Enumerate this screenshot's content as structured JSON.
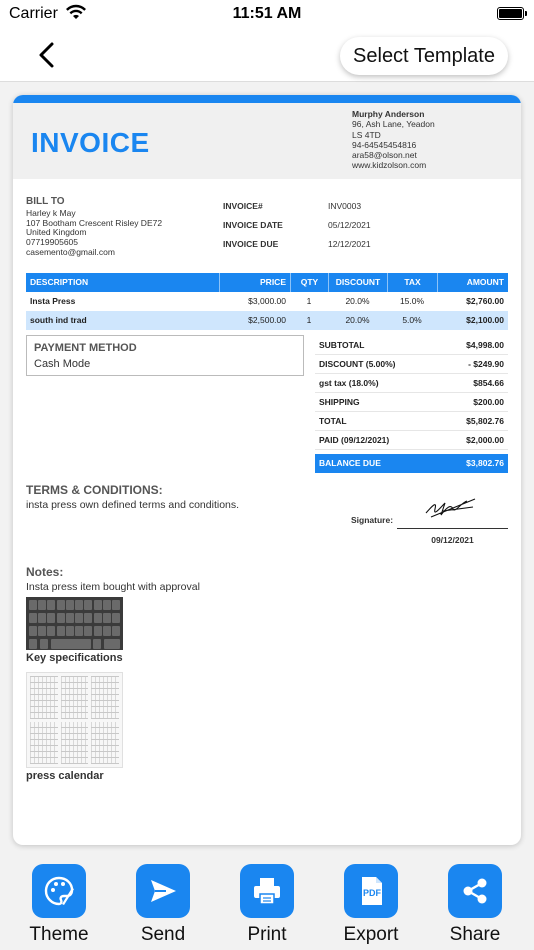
{
  "status_bar": {
    "carrier": "Carrier",
    "time": "11:51 AM"
  },
  "navbar": {
    "select_template_label": "Select Template"
  },
  "invoice": {
    "title": "INVOICE",
    "company": {
      "name": "Murphy Anderson",
      "address1": "96, Ash Lane, Yeadon",
      "address2": "LS 4TD",
      "phone": "94-64545454816",
      "email": "ara58@olson.net",
      "website": "www.kidzolson.com"
    },
    "bill_to": {
      "label": "BILL TO",
      "name": "Harley k May",
      "address": "107 Bootham Crescent Risley DE72",
      "country": "United Kingdom",
      "phone": "07719905605",
      "email": "casemento@gmail.com"
    },
    "meta": [
      {
        "label": "INVOICE#",
        "value": "INV0003"
      },
      {
        "label": "INVOICE DATE",
        "value": "05/12/2021"
      },
      {
        "label": "INVOICE DUE",
        "value": "12/12/2021"
      }
    ],
    "columns": [
      "DESCRIPTION",
      "PRICE",
      "QTY",
      "DISCOUNT",
      "TAX",
      "AMOUNT"
    ],
    "items": [
      {
        "description": "Insta Press",
        "price": "$3,000.00",
        "qty": "1",
        "discount": "20.0%",
        "tax": "15.0%",
        "amount": "$2,760.00"
      },
      {
        "description": "south ind trad",
        "price": "$2,500.00",
        "qty": "1",
        "discount": "20.0%",
        "tax": "5.0%",
        "amount": "$2,100.00"
      }
    ],
    "payment": {
      "title": "PAYMENT METHOD",
      "value": "Cash Mode"
    },
    "totals": [
      {
        "label": "SUBTOTAL",
        "value": "$4,998.00"
      },
      {
        "label": "DISCOUNT (5.00%)",
        "value": "- $249.90"
      },
      {
        "label": "gst tax (18.0%)",
        "value": "$854.66"
      },
      {
        "label": "SHIPPING",
        "value": "$200.00"
      },
      {
        "label": "TOTAL",
        "value": "$5,802.76"
      },
      {
        "label": "PAID (09/12/2021)",
        "value": "$2,000.00"
      }
    ],
    "balance": {
      "label": "BALANCE DUE",
      "value": "$3,802.76"
    },
    "terms": {
      "title": "TERMS & CONDITIONS:",
      "text": "insta press own defined terms and conditions."
    },
    "signature": {
      "label": "Signature:",
      "date": "09/12/2021"
    },
    "notes": {
      "title": "Notes:",
      "text": "Insta press item bought with approval"
    },
    "images": [
      {
        "caption": "Key specifications"
      },
      {
        "caption": "press calendar"
      }
    ]
  },
  "toolbar": {
    "items": [
      {
        "label": "Theme",
        "icon": "palette-icon"
      },
      {
        "label": "Send",
        "icon": "send-icon"
      },
      {
        "label": "Print",
        "icon": "printer-icon"
      },
      {
        "label": "Export",
        "icon": "pdf-icon"
      },
      {
        "label": "Share",
        "icon": "share-icon"
      }
    ]
  },
  "colors": {
    "accent": "#1a86f0",
    "row_alt": "#cfe6fd"
  }
}
